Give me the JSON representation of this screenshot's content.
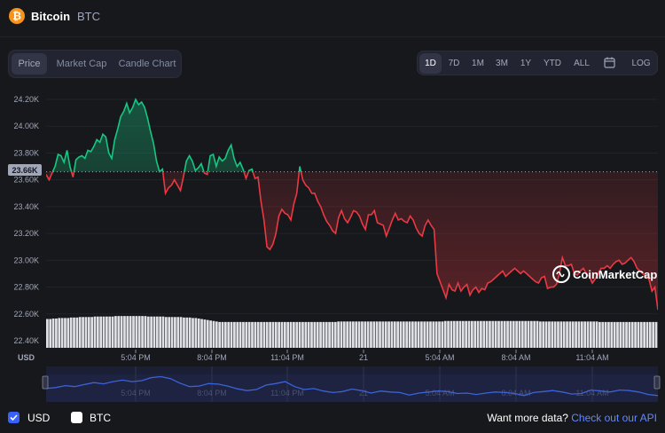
{
  "header": {
    "coin_icon": "bitcoin-icon",
    "coin_icon_glyph": "₿",
    "coin_name": "Bitcoin",
    "coin_symbol": "BTC"
  },
  "chart_tabs": [
    {
      "label": "Price",
      "active": true
    },
    {
      "label": "Market Cap",
      "active": false
    },
    {
      "label": "Candle Chart",
      "active": false
    }
  ],
  "time_ranges": [
    {
      "label": "1D",
      "active": true
    },
    {
      "label": "7D",
      "active": false
    },
    {
      "label": "1M",
      "active": false
    },
    {
      "label": "3M",
      "active": false
    },
    {
      "label": "1Y",
      "active": false
    },
    {
      "label": "YTD",
      "active": false
    },
    {
      "label": "ALL",
      "active": false
    }
  ],
  "calendar_icon": "calendar-icon",
  "log_label": "LOG",
  "watermark": "CoinMarketCap",
  "currency_axis_label": "USD",
  "footer": {
    "usd_label": "USD",
    "usd_checked": true,
    "btc_label": "BTC",
    "btc_checked": false,
    "cta_text": "Want more data?",
    "cta_link": "Check out our API"
  },
  "colors": {
    "up": "#16c784",
    "down": "#ea3943",
    "nav_line": "#3b63d9",
    "accent": "#6188ff"
  },
  "chart_data": {
    "type": "line",
    "title": "",
    "y_ticks": [
      "24.20K",
      "24.00K",
      "23.80K",
      "23.60K",
      "23.40K",
      "23.20K",
      "23.00K",
      "22.80K",
      "22.60K",
      "22.40K"
    ],
    "ylim": [
      22400,
      24200
    ],
    "x_ticks": [
      "5:04 PM",
      "8:04 PM",
      "11:04 PM",
      "21",
      "5:04 AM",
      "8:04 AM",
      "11:04 AM"
    ],
    "baseline": {
      "value": 23660,
      "label": "23.66K"
    },
    "price_series": [
      [
        0,
        23640
      ],
      [
        1,
        23600
      ],
      [
        2,
        23650
      ],
      [
        3,
        23700
      ],
      [
        4,
        23790
      ],
      [
        5,
        23780
      ],
      [
        6,
        23730
      ],
      [
        7,
        23820
      ],
      [
        8,
        23700
      ],
      [
        9,
        23620
      ],
      [
        10,
        23750
      ],
      [
        11,
        23770
      ],
      [
        12,
        23780
      ],
      [
        13,
        23760
      ],
      [
        14,
        23820
      ],
      [
        15,
        23810
      ],
      [
        16,
        23850
      ],
      [
        17,
        23900
      ],
      [
        18,
        23880
      ],
      [
        19,
        23940
      ],
      [
        20,
        23920
      ],
      [
        21,
        23800
      ],
      [
        22,
        23760
      ],
      [
        23,
        23900
      ],
      [
        24,
        23980
      ],
      [
        25,
        24070
      ],
      [
        26,
        24110
      ],
      [
        27,
        24170
      ],
      [
        28,
        24100
      ],
      [
        29,
        24140
      ],
      [
        30,
        24200
      ],
      [
        31,
        24160
      ],
      [
        32,
        24180
      ],
      [
        33,
        24140
      ],
      [
        34,
        24060
      ],
      [
        35,
        23960
      ],
      [
        36,
        23870
      ],
      [
        37,
        23740
      ],
      [
        38,
        23660
      ],
      [
        39,
        23680
      ],
      [
        40,
        23500
      ],
      [
        41,
        23540
      ],
      [
        42,
        23560
      ],
      [
        43,
        23600
      ],
      [
        44,
        23560
      ],
      [
        45,
        23520
      ],
      [
        46,
        23620
      ],
      [
        47,
        23740
      ],
      [
        48,
        23780
      ],
      [
        49,
        23740
      ],
      [
        50,
        23670
      ],
      [
        51,
        23690
      ],
      [
        52,
        23720
      ],
      [
        53,
        23650
      ],
      [
        54,
        23640
      ],
      [
        55,
        23780
      ],
      [
        56,
        23790
      ],
      [
        57,
        23700
      ],
      [
        58,
        23770
      ],
      [
        59,
        23740
      ],
      [
        60,
        23760
      ],
      [
        61,
        23820
      ],
      [
        62,
        23860
      ],
      [
        63,
        23760
      ],
      [
        64,
        23700
      ],
      [
        65,
        23730
      ],
      [
        66,
        23680
      ],
      [
        67,
        23610
      ],
      [
        68,
        23670
      ],
      [
        69,
        23680
      ],
      [
        70,
        23610
      ],
      [
        71,
        23620
      ],
      [
        72,
        23440
      ],
      [
        73,
        23300
      ],
      [
        74,
        23100
      ],
      [
        75,
        23080
      ],
      [
        76,
        23120
      ],
      [
        77,
        23200
      ],
      [
        78,
        23330
      ],
      [
        79,
        23380
      ],
      [
        80,
        23350
      ],
      [
        81,
        23340
      ],
      [
        82,
        23300
      ],
      [
        83,
        23420
      ],
      [
        84,
        23500
      ],
      [
        85,
        23700
      ],
      [
        86,
        23600
      ],
      [
        87,
        23560
      ],
      [
        88,
        23540
      ],
      [
        89,
        23500
      ],
      [
        90,
        23500
      ],
      [
        91,
        23440
      ],
      [
        92,
        23400
      ],
      [
        93,
        23340
      ],
      [
        94,
        23290
      ],
      [
        95,
        23260
      ],
      [
        96,
        23220
      ],
      [
        97,
        23200
      ],
      [
        98,
        23320
      ],
      [
        99,
        23370
      ],
      [
        100,
        23310
      ],
      [
        101,
        23280
      ],
      [
        102,
        23320
      ],
      [
        103,
        23370
      ],
      [
        104,
        23360
      ],
      [
        105,
        23330
      ],
      [
        106,
        23270
      ],
      [
        107,
        23230
      ],
      [
        108,
        23340
      ],
      [
        109,
        23340
      ],
      [
        110,
        23370
      ],
      [
        111,
        23280
      ],
      [
        112,
        23270
      ],
      [
        113,
        23260
      ],
      [
        114,
        23180
      ],
      [
        115,
        23240
      ],
      [
        116,
        23300
      ],
      [
        117,
        23350
      ],
      [
        118,
        23300
      ],
      [
        119,
        23310
      ],
      [
        120,
        23290
      ],
      [
        121,
        23280
      ],
      [
        122,
        23330
      ],
      [
        123,
        23300
      ],
      [
        124,
        23240
      ],
      [
        125,
        23200
      ],
      [
        126,
        23180
      ],
      [
        127,
        23260
      ],
      [
        128,
        23300
      ],
      [
        129,
        23260
      ],
      [
        130,
        23230
      ],
      [
        131,
        22900
      ],
      [
        132,
        22840
      ],
      [
        133,
        22780
      ],
      [
        134,
        22720
      ],
      [
        135,
        22820
      ],
      [
        136,
        22780
      ],
      [
        137,
        22770
      ],
      [
        138,
        22830
      ],
      [
        139,
        22770
      ],
      [
        140,
        22800
      ],
      [
        141,
        22820
      ],
      [
        142,
        22740
      ],
      [
        143,
        22780
      ],
      [
        144,
        22800
      ],
      [
        145,
        22760
      ],
      [
        146,
        22790
      ],
      [
        147,
        22780
      ],
      [
        148,
        22830
      ],
      [
        149,
        22840
      ],
      [
        150,
        22860
      ],
      [
        151,
        22880
      ],
      [
        152,
        22900
      ],
      [
        153,
        22920
      ],
      [
        154,
        22880
      ],
      [
        155,
        22900
      ],
      [
        156,
        22920
      ],
      [
        157,
        22940
      ],
      [
        158,
        22920
      ],
      [
        159,
        22900
      ],
      [
        160,
        22920
      ],
      [
        161,
        22900
      ],
      [
        162,
        22880
      ],
      [
        163,
        22860
      ],
      [
        164,
        22840
      ],
      [
        165,
        22830
      ],
      [
        166,
        22870
      ],
      [
        167,
        22880
      ],
      [
        168,
        22790
      ],
      [
        169,
        22800
      ],
      [
        170,
        22800
      ],
      [
        171,
        22820
      ],
      [
        172,
        22900
      ],
      [
        173,
        23020
      ],
      [
        174,
        22960
      ],
      [
        175,
        22960
      ],
      [
        176,
        22970
      ],
      [
        177,
        22900
      ],
      [
        178,
        22890
      ],
      [
        179,
        22920
      ],
      [
        180,
        22940
      ],
      [
        181,
        22900
      ],
      [
        182,
        22880
      ],
      [
        183,
        22830
      ],
      [
        184,
        22860
      ],
      [
        185,
        22900
      ],
      [
        186,
        22940
      ],
      [
        187,
        22940
      ],
      [
        188,
        22960
      ],
      [
        189,
        22940
      ],
      [
        190,
        22970
      ],
      [
        191,
        22990
      ],
      [
        192,
        23000
      ],
      [
        193,
        22970
      ],
      [
        194,
        22980
      ],
      [
        195,
        23000
      ],
      [
        196,
        23020
      ],
      [
        197,
        22990
      ],
      [
        198,
        22940
      ],
      [
        199,
        22920
      ],
      [
        200,
        22900
      ],
      [
        201,
        22880
      ],
      [
        202,
        22860
      ],
      [
        203,
        22770
      ],
      [
        204,
        22800
      ],
      [
        205,
        22630
      ]
    ],
    "volume_series": [
      0.58,
      0.58,
      0.59,
      0.59,
      0.6,
      0.6,
      0.6,
      0.6,
      0.61,
      0.61,
      0.61,
      0.62,
      0.62,
      0.62,
      0.62,
      0.62,
      0.63,
      0.63,
      0.63,
      0.63,
      0.63,
      0.63,
      0.63,
      0.64,
      0.64,
      0.64,
      0.64,
      0.64,
      0.64,
      0.64,
      0.64,
      0.64,
      0.64,
      0.64,
      0.63,
      0.63,
      0.63,
      0.63,
      0.63,
      0.63,
      0.62,
      0.62,
      0.62,
      0.62,
      0.62,
      0.62,
      0.61,
      0.61,
      0.61,
      0.6,
      0.6,
      0.59,
      0.58,
      0.57,
      0.56,
      0.55,
      0.54,
      0.53,
      0.52,
      0.52,
      0.52,
      0.52,
      0.52,
      0.52,
      0.52,
      0.52,
      0.52,
      0.52,
      0.52,
      0.52,
      0.52,
      0.52,
      0.52,
      0.52,
      0.52,
      0.52,
      0.52,
      0.52,
      0.52,
      0.52,
      0.52,
      0.52,
      0.52,
      0.52,
      0.52,
      0.52,
      0.52,
      0.52,
      0.52,
      0.52,
      0.52,
      0.52,
      0.52,
      0.52,
      0.52,
      0.52,
      0.52,
      0.52,
      0.53,
      0.53,
      0.53,
      0.53,
      0.53,
      0.53,
      0.53,
      0.53,
      0.53,
      0.53,
      0.53,
      0.53,
      0.53,
      0.53,
      0.53,
      0.53,
      0.53,
      0.53,
      0.53,
      0.53,
      0.53,
      0.53,
      0.53,
      0.53,
      0.53,
      0.53,
      0.53,
      0.53,
      0.53,
      0.53,
      0.53,
      0.53,
      0.53,
      0.53,
      0.53,
      0.53,
      0.54,
      0.54,
      0.54,
      0.54,
      0.54,
      0.54,
      0.54,
      0.54,
      0.54,
      0.54,
      0.54,
      0.54,
      0.54,
      0.54,
      0.54,
      0.54,
      0.54,
      0.54,
      0.54,
      0.54,
      0.54,
      0.54,
      0.54,
      0.54,
      0.54,
      0.54,
      0.54,
      0.54,
      0.54,
      0.54,
      0.54,
      0.54,
      0.53,
      0.53,
      0.53,
      0.53,
      0.53,
      0.53,
      0.53,
      0.53,
      0.53,
      0.53,
      0.53,
      0.53,
      0.53,
      0.53,
      0.53,
      0.53,
      0.53,
      0.53,
      0.53,
      0.53,
      0.52,
      0.52,
      0.52,
      0.52,
      0.52,
      0.52,
      0.52,
      0.52,
      0.52,
      0.52,
      0.52,
      0.52,
      0.52,
      0.52,
      0.52,
      0.52,
      0.52,
      0.52,
      0.52,
      0.52
    ],
    "navigator_series": [
      0.36,
      0.4,
      0.48,
      0.44,
      0.52,
      0.6,
      0.55,
      0.64,
      0.7,
      0.64,
      0.68,
      0.8,
      0.84,
      0.76,
      0.58,
      0.44,
      0.46,
      0.56,
      0.54,
      0.46,
      0.35,
      0.28,
      0.32,
      0.5,
      0.56,
      0.64,
      0.44,
      0.32,
      0.36,
      0.26,
      0.2,
      0.24,
      0.34,
      0.28,
      0.18,
      0.26,
      0.22,
      0.2,
      0.1,
      0.18,
      0.22,
      0.26,
      0.24,
      0.16,
      0.18,
      0.12,
      0.18,
      0.22,
      0.2,
      0.16,
      0.08,
      0.2,
      0.24,
      0.28,
      0.22,
      0.14,
      0.16,
      0.3,
      0.26,
      0.22,
      0.3,
      0.28,
      0.22,
      0.12,
      0.08
    ]
  }
}
